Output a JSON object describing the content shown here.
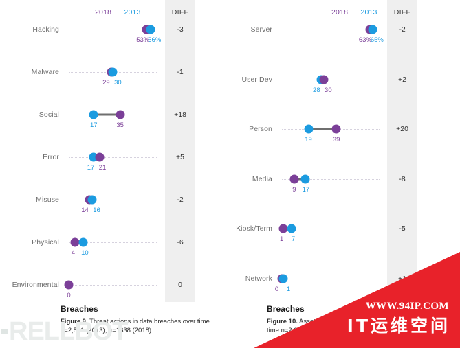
{
  "legend": {
    "year_2018": "2018",
    "year_2013": "2013",
    "diff_header": "DIFF"
  },
  "colors": {
    "purple_2018": "#7B3F98",
    "blue_2013": "#1B9BE0",
    "connector": "#6F6F6F",
    "diff_strip": "#EFEFEF",
    "watermark_red": "#E8222A"
  },
  "figure9": {
    "caption_title": "Breaches",
    "caption_label": "Figure 9.",
    "caption_text": " Threat actions in data breaches over time n=2,501 (2013), n=1638 (2018)"
  },
  "figure10": {
    "caption_title": "Breaches",
    "caption_label": "Figure 10.",
    "caption_text": " Asset categories in data breaches over time n=2,294 (2013), n=2013 (2018)"
  },
  "watermark": {
    "left_text": "RELLBOT",
    "url": "WWW.94IP.COM",
    "tagline": "IT运维空间"
  },
  "chart_data": [
    {
      "type": "dumbbell",
      "title": "Breaches",
      "caption": "Figure 9. Threat actions in data breaches over time n=2,501 (2013), n=1638 (2018)",
      "series": [
        {
          "name": "2018",
          "color": "#7B3F98"
        },
        {
          "name": "2013",
          "color": "#1B9BE0"
        }
      ],
      "xlabel": "",
      "ylabel": "",
      "xlim": [
        0,
        60
      ],
      "grid": "dotted-row",
      "legend_position": "top",
      "rows": [
        {
          "category": "Hacking",
          "v2018": 53,
          "v2013": 56,
          "label2018": "53%",
          "label2013": "56%",
          "diff": "-3"
        },
        {
          "category": "Malware",
          "v2018": 29,
          "v2013": 30,
          "label2018": "29",
          "label2013": "30",
          "diff": "-1"
        },
        {
          "category": "Social",
          "v2018": 35,
          "v2013": 17,
          "label2018": "35",
          "label2013": "17",
          "diff": "+18"
        },
        {
          "category": "Error",
          "v2018": 21,
          "v2013": 17,
          "label2018": "21",
          "label2013": "17",
          "diff": "+5"
        },
        {
          "category": "Misuse",
          "v2018": 14,
          "v2013": 16,
          "label2018": "14",
          "label2013": "16",
          "diff": "-2"
        },
        {
          "category": "Physical",
          "v2018": 4,
          "v2013": 10,
          "label2018": "4",
          "label2013": "10",
          "diff": "-6"
        },
        {
          "category": "Environmental",
          "v2018": 0,
          "v2013": 0,
          "label2018": "0",
          "label2013": "",
          "diff": "0"
        }
      ]
    },
    {
      "type": "dumbbell",
      "title": "Breaches",
      "caption": "Figure 10. Asset categories in data breaches over time n=2,294 (2013), n=2013 (2018)",
      "series": [
        {
          "name": "2018",
          "color": "#7B3F98"
        },
        {
          "name": "2013",
          "color": "#1B9BE0"
        }
      ],
      "xlabel": "",
      "ylabel": "",
      "xlim": [
        0,
        70
      ],
      "grid": "dotted-row",
      "legend_position": "top",
      "rows": [
        {
          "category": "Server",
          "v2018": 63,
          "v2013": 65,
          "label2018": "63%",
          "label2013": "65%",
          "diff": "-2"
        },
        {
          "category": "User Dev",
          "v2018": 30,
          "v2013": 28,
          "label2018": "30",
          "label2013": "28",
          "diff": "+2"
        },
        {
          "category": "Person",
          "v2018": 39,
          "v2013": 19,
          "label2018": "39",
          "label2013": "19",
          "diff": "+20"
        },
        {
          "category": "Media",
          "v2018": 9,
          "v2013": 17,
          "label2018": "9",
          "label2013": "17",
          "diff": "-8"
        },
        {
          "category": "Kiosk/Term",
          "v2018": 1,
          "v2013": 7,
          "label2018": "1",
          "label2013": "7",
          "diff": "-5"
        },
        {
          "category": "Network",
          "v2018": 0,
          "v2013": 1,
          "label2018": "0",
          "label2013": "1",
          "diff": "+1"
        }
      ]
    }
  ]
}
